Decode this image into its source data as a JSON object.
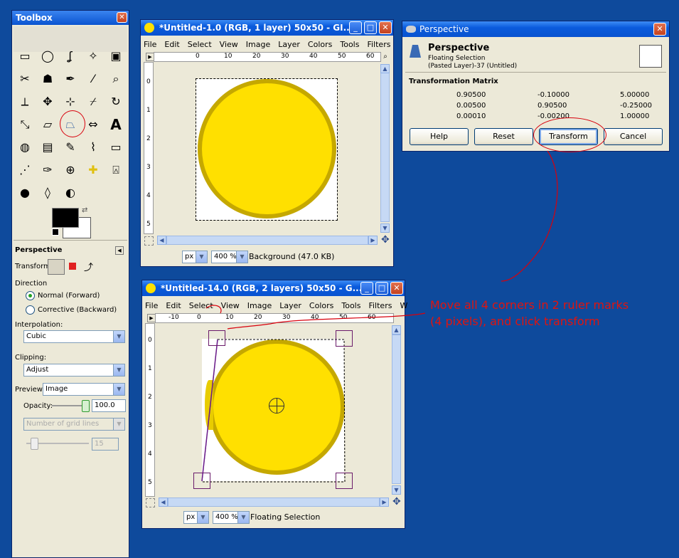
{
  "toolbox": {
    "title": "Toolbox",
    "tools": [
      "rect-select",
      "ellipse-select",
      "free-select",
      "fuzzy-select",
      "color-select",
      "scissors",
      "foreground-select",
      "paths",
      "color-picker",
      "magnify",
      "measure",
      "move",
      "align",
      "crop",
      "rotate",
      "scale",
      "shear",
      "perspective",
      "flip",
      "text",
      "bucket-fill",
      "blend",
      "pencil",
      "paintbrush",
      "eraser",
      "airbrush",
      "ink",
      "clone",
      "heal",
      "perspective-clone",
      "smudge",
      "dodge-burn",
      "blur"
    ],
    "tool_options_title": "Perspective",
    "transform_label": "Transform:",
    "direction_label": "Direction",
    "direction_normal": "Normal (Forward)",
    "direction_corrective": "Corrective (Backward)",
    "interpolation_label": "Interpolation:",
    "interpolation_value": "Cubic",
    "clipping_label": "Clipping:",
    "clipping_value": "Adjust",
    "preview_label": "Preview:",
    "preview_value": "Image",
    "opacity_label": "Opacity:",
    "opacity_value": "100.0",
    "grid_placeholder": "Number of grid lines",
    "grid_value": "15"
  },
  "window1": {
    "title": "*Untitled-1.0 (RGB, 1 layer) 50x50 - GI...",
    "menu": [
      "File",
      "Edit",
      "Select",
      "View",
      "Image",
      "Layer",
      "Colors",
      "Tools",
      "Filters"
    ],
    "ruler_top": [
      "0",
      "10",
      "20",
      "30",
      "40",
      "50",
      "60"
    ],
    "ruler_left": [
      "0",
      "1",
      "2",
      "3",
      "4",
      "5"
    ],
    "unit": "px",
    "zoom": "400 %",
    "status": "Background (47.0 KB)"
  },
  "window2": {
    "title": "*Untitled-14.0 (RGB, 2 layers) 50x50 - G...",
    "menu": [
      "File",
      "Edit",
      "Select",
      "View",
      "Image",
      "Layer",
      "Colors",
      "Tools",
      "Filters",
      "W"
    ],
    "ruler_top": [
      "-10",
      "0",
      "10",
      "20",
      "30",
      "40",
      "50",
      "60"
    ],
    "ruler_left": [
      "0",
      "1",
      "2",
      "3",
      "4",
      "5"
    ],
    "unit": "px",
    "zoom": "400 %",
    "status": "Floating Selection"
  },
  "perspective": {
    "window_title": "Perspective",
    "heading": "Perspective",
    "sub1": "Floating Selection",
    "sub2": "(Pasted Layer)-37 (Untitled)",
    "matrix_title": "Transformation Matrix",
    "matrix": [
      [
        "0.90500",
        "-0.10000",
        "5.00000"
      ],
      [
        "0.00500",
        "0.90500",
        "-0.25000"
      ],
      [
        "0.00010",
        "-0.00200",
        "1.00000"
      ]
    ],
    "help": "Help",
    "reset": "Reset",
    "transform": "Transform",
    "cancel": "Cancel"
  },
  "annotation": {
    "line1": "Move all 4 corners in 2 ruler marks",
    "line2": "(4 pixels), and click transform",
    "color": "#e0140f"
  }
}
